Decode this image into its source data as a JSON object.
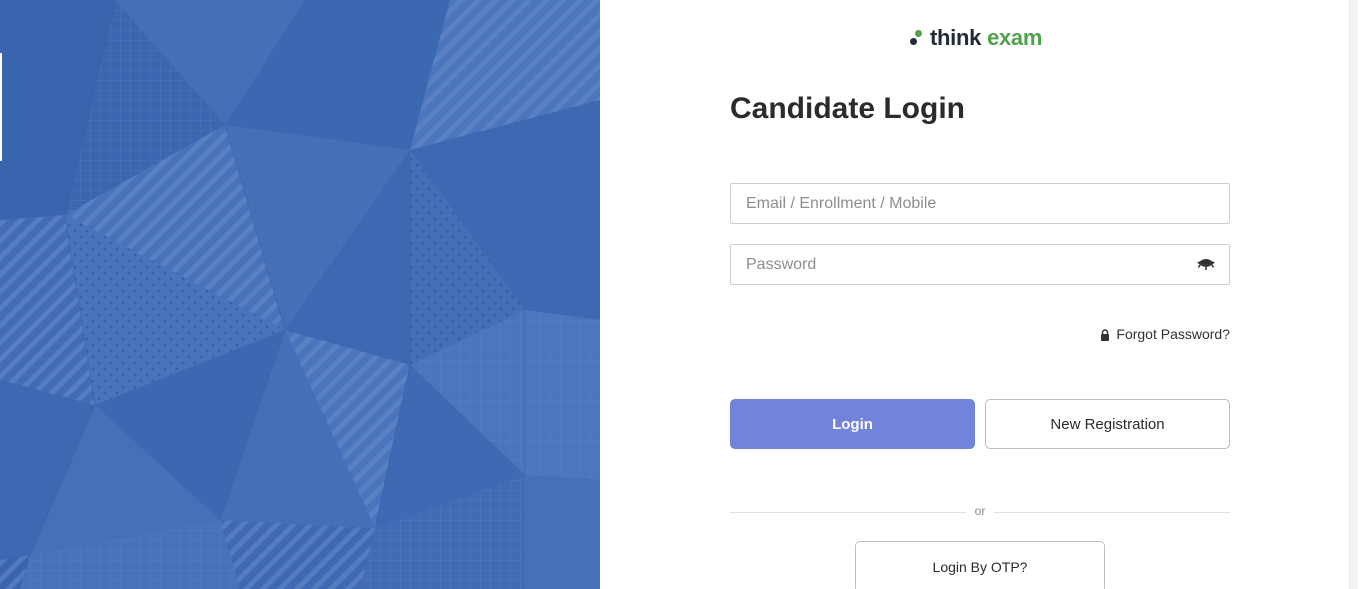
{
  "brand": {
    "name_part1": "think",
    "name_part2": "exam",
    "dark_color": "#222a3a",
    "green_color": "#4fa24a"
  },
  "login_form": {
    "title": "Candidate Login",
    "email_placeholder": "Email / Enrollment / Mobile",
    "password_placeholder": "Password",
    "password_toggle_icon": "eye-closed-icon",
    "forgot_password_icon": "lock-icon",
    "forgot_password_label": "Forgot Password?",
    "login_label": "Login",
    "register_label": "New Registration",
    "divider_label": "or",
    "otp_label": "Login By OTP?"
  },
  "colors": {
    "left_panel_bg": "#3f6ab3",
    "login_button_bg": "#7183db"
  }
}
